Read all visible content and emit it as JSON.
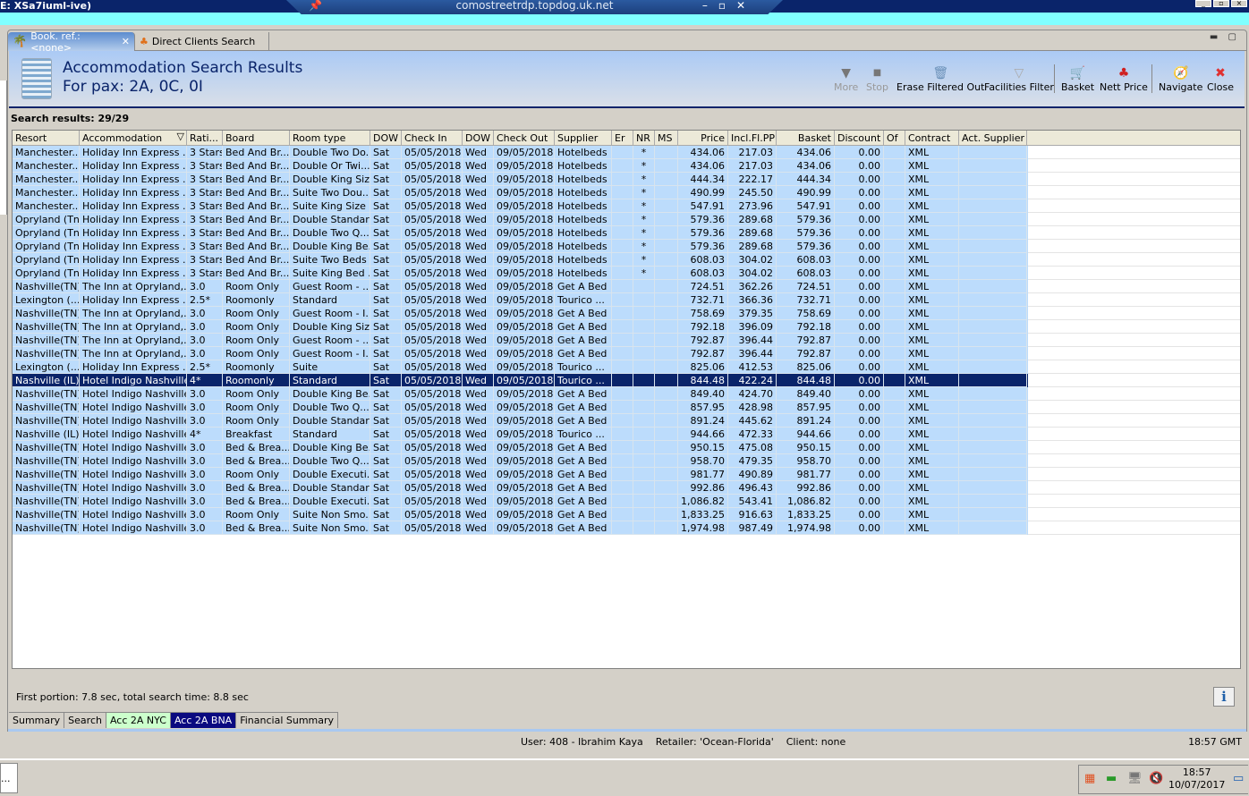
{
  "system": {
    "window_title": "E: XSa7iuml-ive)",
    "rdp_host": "comostreetrdp.topdog.uk.net"
  },
  "tabs": [
    {
      "label": "Book. ref.: <none>",
      "icon": "palm-tree-icon",
      "closable": true
    },
    {
      "label": "Direct Clients Search",
      "icon": "clients-icon"
    }
  ],
  "header": {
    "title": "Accommodation Search Results",
    "pax": "For pax: 2A, 0C, 0I"
  },
  "toolbar": [
    {
      "label": "More",
      "icon": "triangle-down-icon",
      "enabled": false
    },
    {
      "label": "Stop",
      "icon": "stop-icon",
      "enabled": false
    },
    {
      "label": "Erase Filtered Out",
      "icon": "erase-icon",
      "enabled": true
    },
    {
      "label": "Facilities Filter",
      "icon": "funnel-icon",
      "enabled": true
    },
    {
      "label": "Basket",
      "icon": "cart-icon",
      "enabled": true
    },
    {
      "label": "Nett Price",
      "icon": "nett-price-icon",
      "enabled": true
    },
    {
      "label": "Navigate",
      "icon": "compass-icon",
      "enabled": true
    },
    {
      "label": "Close",
      "icon": "close-icon",
      "enabled": true
    }
  ],
  "search_results": "Search results: 29/29",
  "columns": [
    "Resort",
    "Accommodation",
    "Rati...",
    "Board",
    "Room type",
    "DOW",
    "Check In",
    "DOW",
    "Check Out",
    "Supplier",
    "Er",
    "NR",
    "MS",
    "Price",
    "Incl.Fl.PP",
    "Basket",
    "Discount",
    "Of",
    "Contract",
    "Act. Supplier"
  ],
  "selected_row": 17,
  "rows": [
    [
      "Manchester...",
      "Holiday Inn Express ...",
      "3 Stars",
      "Bed And Br...",
      "Double Two Do...",
      "Sat",
      "05/05/2018",
      "Wed",
      "09/05/2018",
      "Hotelbeds",
      "",
      "*",
      "",
      "434.06",
      "217.03",
      "434.06",
      "0.00",
      "",
      "XML",
      ""
    ],
    [
      "Manchester...",
      "Holiday Inn Express ...",
      "3 Stars",
      "Bed And Br...",
      "Double Or Twi...",
      "Sat",
      "05/05/2018",
      "Wed",
      "09/05/2018",
      "Hotelbeds",
      "",
      "*",
      "",
      "434.06",
      "217.03",
      "434.06",
      "0.00",
      "",
      "XML",
      ""
    ],
    [
      "Manchester...",
      "Holiday Inn Express ...",
      "3 Stars",
      "Bed And Br...",
      "Double King Siz...",
      "Sat",
      "05/05/2018",
      "Wed",
      "09/05/2018",
      "Hotelbeds",
      "",
      "*",
      "",
      "444.34",
      "222.17",
      "444.34",
      "0.00",
      "",
      "XML",
      ""
    ],
    [
      "Manchester...",
      "Holiday Inn Express ...",
      "3 Stars",
      "Bed And Br...",
      "Suite Two Dou...",
      "Sat",
      "05/05/2018",
      "Wed",
      "09/05/2018",
      "Hotelbeds",
      "",
      "*",
      "",
      "490.99",
      "245.50",
      "490.99",
      "0.00",
      "",
      "XML",
      ""
    ],
    [
      "Manchester...",
      "Holiday Inn Express ...",
      "3 Stars",
      "Bed And Br...",
      "Suite King Size ...",
      "Sat",
      "05/05/2018",
      "Wed",
      "09/05/2018",
      "Hotelbeds",
      "",
      "*",
      "",
      "547.91",
      "273.96",
      "547.91",
      "0.00",
      "",
      "XML",
      ""
    ],
    [
      "Opryland (Tn)",
      "Holiday Inn Express ...",
      "3 Stars",
      "Bed And Br...",
      "Double Standard",
      "Sat",
      "05/05/2018",
      "Wed",
      "09/05/2018",
      "Hotelbeds",
      "",
      "*",
      "",
      "579.36",
      "289.68",
      "579.36",
      "0.00",
      "",
      "XML",
      ""
    ],
    [
      "Opryland (Tn)",
      "Holiday Inn Express ...",
      "3 Stars",
      "Bed And Br...",
      "Double Two Q...",
      "Sat",
      "05/05/2018",
      "Wed",
      "09/05/2018",
      "Hotelbeds",
      "",
      "*",
      "",
      "579.36",
      "289.68",
      "579.36",
      "0.00",
      "",
      "XML",
      ""
    ],
    [
      "Opryland (Tn)",
      "Holiday Inn Express ...",
      "3 Stars",
      "Bed And Br...",
      "Double King Be...",
      "Sat",
      "05/05/2018",
      "Wed",
      "09/05/2018",
      "Hotelbeds",
      "",
      "*",
      "",
      "579.36",
      "289.68",
      "579.36",
      "0.00",
      "",
      "XML",
      ""
    ],
    [
      "Opryland (Tn)",
      "Holiday Inn Express ...",
      "3 Stars",
      "Bed And Br...",
      "Suite Two Beds",
      "Sat",
      "05/05/2018",
      "Wed",
      "09/05/2018",
      "Hotelbeds",
      "",
      "*",
      "",
      "608.03",
      "304.02",
      "608.03",
      "0.00",
      "",
      "XML",
      ""
    ],
    [
      "Opryland (Tn)",
      "Holiday Inn Express ...",
      "3 Stars",
      "Bed And Br...",
      "Suite King Bed ...",
      "Sat",
      "05/05/2018",
      "Wed",
      "09/05/2018",
      "Hotelbeds",
      "",
      "*",
      "",
      "608.03",
      "304.02",
      "608.03",
      "0.00",
      "",
      "XML",
      ""
    ],
    [
      "Nashville(TN)",
      "The Inn at Opryland,...",
      "3.0",
      "Room Only",
      "Guest Room - ...",
      "Sat",
      "05/05/2018",
      "Wed",
      "09/05/2018",
      "Get A Bed",
      "",
      "",
      "",
      "724.51",
      "362.26",
      "724.51",
      "0.00",
      "",
      "XML",
      ""
    ],
    [
      "Lexington (...",
      "Holiday Inn Express ...",
      "2.5*",
      "Roomonly",
      "Standard",
      "Sat",
      "05/05/2018",
      "Wed",
      "09/05/2018",
      "Tourico ...",
      "",
      "",
      "",
      "732.71",
      "366.36",
      "732.71",
      "0.00",
      "",
      "XML",
      ""
    ],
    [
      "Nashville(TN)",
      "The Inn at Opryland,...",
      "3.0",
      "Room Only",
      "Guest Room - I...",
      "Sat",
      "05/05/2018",
      "Wed",
      "09/05/2018",
      "Get A Bed",
      "",
      "",
      "",
      "758.69",
      "379.35",
      "758.69",
      "0.00",
      "",
      "XML",
      ""
    ],
    [
      "Nashville(TN)",
      "The Inn at Opryland,...",
      "3.0",
      "Room Only",
      "Double King Siz...",
      "Sat",
      "05/05/2018",
      "Wed",
      "09/05/2018",
      "Get A Bed",
      "",
      "",
      "",
      "792.18",
      "396.09",
      "792.18",
      "0.00",
      "",
      "XML",
      ""
    ],
    [
      "Nashville(TN)",
      "The Inn at Opryland,...",
      "3.0",
      "Room Only",
      "Guest Room - ...",
      "Sat",
      "05/05/2018",
      "Wed",
      "09/05/2018",
      "Get A Bed",
      "",
      "",
      "",
      "792.87",
      "396.44",
      "792.87",
      "0.00",
      "",
      "XML",
      ""
    ],
    [
      "Nashville(TN)",
      "The Inn at Opryland,...",
      "3.0",
      "Room Only",
      "Guest Room - I...",
      "Sat",
      "05/05/2018",
      "Wed",
      "09/05/2018",
      "Get A Bed",
      "",
      "",
      "",
      "792.87",
      "396.44",
      "792.87",
      "0.00",
      "",
      "XML",
      ""
    ],
    [
      "Lexington (...",
      "Holiday Inn Express ...",
      "2.5*",
      "Roomonly",
      "Suite",
      "Sat",
      "05/05/2018",
      "Wed",
      "09/05/2018",
      "Tourico ...",
      "",
      "",
      "",
      "825.06",
      "412.53",
      "825.06",
      "0.00",
      "",
      "XML",
      ""
    ],
    [
      "Nashville (IL)",
      "Hotel Indigo Nashville",
      "4*",
      "Roomonly",
      "Standard",
      "Sat",
      "05/05/2018",
      "Wed",
      "09/05/2018",
      "Tourico ...",
      "",
      "",
      "",
      "844.48",
      "422.24",
      "844.48",
      "0.00",
      "",
      "XML",
      ""
    ],
    [
      "Nashville(TN)",
      "Hotel Indigo Nashville",
      "3.0",
      "Room Only",
      "Double King Be...",
      "Sat",
      "05/05/2018",
      "Wed",
      "09/05/2018",
      "Get A Bed",
      "",
      "",
      "",
      "849.40",
      "424.70",
      "849.40",
      "0.00",
      "",
      "XML",
      ""
    ],
    [
      "Nashville(TN)",
      "Hotel Indigo Nashville",
      "3.0",
      "Room Only",
      "Double Two Q...",
      "Sat",
      "05/05/2018",
      "Wed",
      "09/05/2018",
      "Get A Bed",
      "",
      "",
      "",
      "857.95",
      "428.98",
      "857.95",
      "0.00",
      "",
      "XML",
      ""
    ],
    [
      "Nashville(TN)",
      "Hotel Indigo Nashville",
      "3.0",
      "Room Only",
      "Double Standard",
      "Sat",
      "05/05/2018",
      "Wed",
      "09/05/2018",
      "Get A Bed",
      "",
      "",
      "",
      "891.24",
      "445.62",
      "891.24",
      "0.00",
      "",
      "XML",
      ""
    ],
    [
      "Nashville (IL)",
      "Hotel Indigo Nashville",
      "4*",
      "Breakfast",
      "Standard",
      "Sat",
      "05/05/2018",
      "Wed",
      "09/05/2018",
      "Tourico ...",
      "",
      "",
      "",
      "944.66",
      "472.33",
      "944.66",
      "0.00",
      "",
      "XML",
      ""
    ],
    [
      "Nashville(TN)",
      "Hotel Indigo Nashville",
      "3.0",
      "Bed & Brea...",
      "Double King Be...",
      "Sat",
      "05/05/2018",
      "Wed",
      "09/05/2018",
      "Get A Bed",
      "",
      "",
      "",
      "950.15",
      "475.08",
      "950.15",
      "0.00",
      "",
      "XML",
      ""
    ],
    [
      "Nashville(TN)",
      "Hotel Indigo Nashville",
      "3.0",
      "Bed & Brea...",
      "Double Two Q...",
      "Sat",
      "05/05/2018",
      "Wed",
      "09/05/2018",
      "Get A Bed",
      "",
      "",
      "",
      "958.70",
      "479.35",
      "958.70",
      "0.00",
      "",
      "XML",
      ""
    ],
    [
      "Nashville(TN)",
      "Hotel Indigo Nashville",
      "3.0",
      "Room Only",
      "Double Executi...",
      "Sat",
      "05/05/2018",
      "Wed",
      "09/05/2018",
      "Get A Bed",
      "",
      "",
      "",
      "981.77",
      "490.89",
      "981.77",
      "0.00",
      "",
      "XML",
      ""
    ],
    [
      "Nashville(TN)",
      "Hotel Indigo Nashville",
      "3.0",
      "Bed & Brea...",
      "Double Standard",
      "Sat",
      "05/05/2018",
      "Wed",
      "09/05/2018",
      "Get A Bed",
      "",
      "",
      "",
      "992.86",
      "496.43",
      "992.86",
      "0.00",
      "",
      "XML",
      ""
    ],
    [
      "Nashville(TN)",
      "Hotel Indigo Nashville",
      "3.0",
      "Bed & Brea...",
      "Double Executi...",
      "Sat",
      "05/05/2018",
      "Wed",
      "09/05/2018",
      "Get A Bed",
      "",
      "",
      "",
      "1,086.82",
      "543.41",
      "1,086.82",
      "0.00",
      "",
      "XML",
      ""
    ],
    [
      "Nashville(TN)",
      "Hotel Indigo Nashville",
      "3.0",
      "Room Only",
      "Suite Non Smo...",
      "Sat",
      "05/05/2018",
      "Wed",
      "09/05/2018",
      "Get A Bed",
      "",
      "",
      "",
      "1,833.25",
      "916.63",
      "1,833.25",
      "0.00",
      "",
      "XML",
      ""
    ],
    [
      "Nashville(TN)",
      "Hotel Indigo Nashville",
      "3.0",
      "Bed & Brea...",
      "Suite Non Smo...",
      "Sat",
      "05/05/2018",
      "Wed",
      "09/05/2018",
      "Get A Bed",
      "",
      "",
      "",
      "1,974.98",
      "987.49",
      "1,974.98",
      "0.00",
      "",
      "XML",
      ""
    ]
  ],
  "status_text": "First portion: 7.8 sec, total search time: 8.8 sec",
  "info_label": "i",
  "bottom_tabs": [
    {
      "label": "Summary"
    },
    {
      "label": "Search"
    },
    {
      "label": "Acc 2A NYC",
      "color": "#ccffcc"
    },
    {
      "label": "Acc 2A BNA",
      "active": true
    },
    {
      "label": "Financial Summary"
    }
  ],
  "statusbar": {
    "user": "User: 408 - Ibrahim Kaya    Retailer: 'Ocean-Florida'    Client: none",
    "time": "18:57 GMT"
  },
  "taskbar": {
    "item": "...",
    "clock_time": "18:57",
    "clock_date": "10/07/2017"
  },
  "colors": {
    "selected_row": "#0a246a",
    "row_bg": "#bcdcfc",
    "header_accent": "#0a246a"
  }
}
